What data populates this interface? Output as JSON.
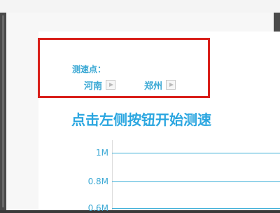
{
  "speedtest": {
    "station_label": "测速点：",
    "nodes": [
      {
        "name": "河南"
      },
      {
        "name": "郑州"
      }
    ],
    "headline": "点击左侧按钮开始测速"
  },
  "chart_data": {
    "type": "line",
    "yticks": [
      "1M",
      "0.8M",
      "0.6M"
    ],
    "series": []
  },
  "colors": {
    "accent": "#2aa6e0",
    "highlight_frame": "#d9201b"
  }
}
